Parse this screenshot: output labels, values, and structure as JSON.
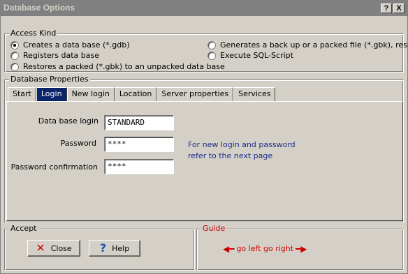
{
  "window": {
    "title": "Database Options",
    "help_button": "?",
    "close_button": "X"
  },
  "access_kind": {
    "label": "Access Kind",
    "options": [
      {
        "label": "Creates a data base (*.gdb)",
        "checked": true
      },
      {
        "label": "Registers data base",
        "checked": false
      },
      {
        "label": "Restores a packed (*.gbk) to an unpacked data base",
        "checked": false
      },
      {
        "label": "Generates a back up or a packed file (*.gbk), resp.",
        "checked": false
      },
      {
        "label": "Execute SQL-Script",
        "checked": false
      }
    ]
  },
  "database_properties": {
    "label": "Database Properties",
    "tabs": [
      {
        "label": "Start",
        "active": false
      },
      {
        "label": "Login",
        "active": true
      },
      {
        "label": "New login",
        "active": false
      },
      {
        "label": "Location",
        "active": false
      },
      {
        "label": "Server properties",
        "active": false
      },
      {
        "label": "Services",
        "active": false
      }
    ],
    "fields": {
      "login_label": "Data base login",
      "login_value": "STANDARD",
      "password_label": "Password",
      "password_value": "****",
      "confirm_label": "Password confirmation",
      "confirm_value": "****"
    },
    "hint_line1": "For new login and password",
    "hint_line2": "refer to the next page"
  },
  "accept": {
    "label": "Accept",
    "close_label": "Close",
    "help_label": "Help"
  },
  "guide": {
    "label": "Guide",
    "text": "go left go right"
  },
  "colors": {
    "active_tab": "#0a246a",
    "guide_text": "#cc0000",
    "hint_text": "#1a2a8a"
  }
}
